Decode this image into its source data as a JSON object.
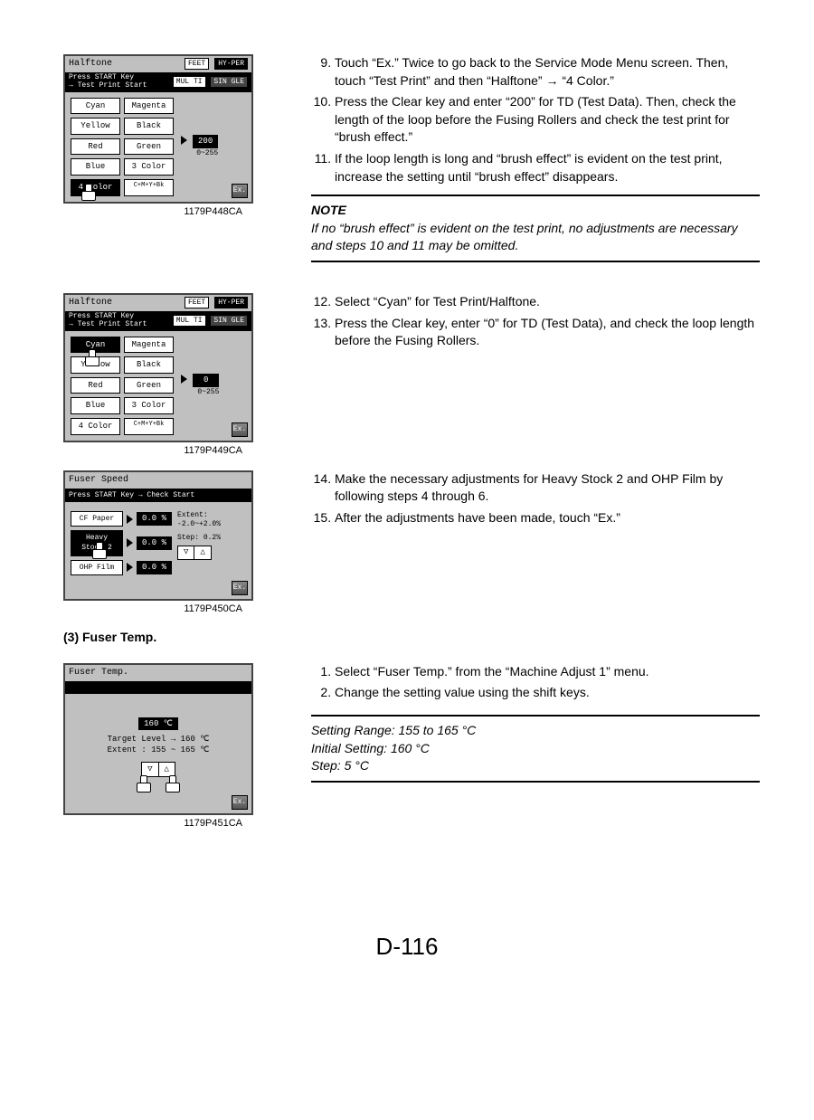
{
  "page_number": "D-116",
  "section_head": "(3)    Fuser Temp.",
  "panel1": {
    "title": "Halftone",
    "feet": "FEET",
    "hyper": "HY-PER",
    "bar": "Press START Key\n→ Test Print Start",
    "mul": "MUL TI",
    "sin": "SIN GLE",
    "c11": "Cyan",
    "c12": "Magenta",
    "c21": "Yellow",
    "c22": "Black",
    "c31": "Red",
    "c32": "Green",
    "c41": "Blue",
    "c42": "3 Color",
    "c51": "4 Color",
    "c52": "C+M+Y+Bk",
    "val": "200",
    "range": "0~255",
    "caption": "1179P448CA"
  },
  "panel2": {
    "title": "Halftone",
    "feet": "FEET",
    "hyper": "HY-PER",
    "bar": "Press START Key\n→ Test Print Start",
    "mul": "MUL TI",
    "sin": "SIN GLE",
    "c11": "Cyan",
    "c12": "Magenta",
    "c21": "Yellow",
    "c22": "Black",
    "c31": "Red",
    "c32": "Green",
    "c41": "Blue",
    "c42": "3 Color",
    "c51": "4 Color",
    "c52": "C+M+Y+Bk",
    "val": "0",
    "range": "0~255",
    "caption": "1179P449CA"
  },
  "panel3": {
    "title": "Fuser Speed",
    "bar": "Press START Key → Check Start",
    "b1": "CF Paper",
    "b2": "Heavy Stock 2",
    "b3": "OHP Film",
    "v": "0.0 %",
    "extent": "Extent:\n-2.0~+2.0%",
    "step": "Step: 0.2%",
    "caption": "1179P450CA"
  },
  "panel4": {
    "title": "Fuser Temp.",
    "val": "160 ℃",
    "target": "Target Level → 160 ℃",
    "extent": "Extent :  155 ~ 165 ℃",
    "caption": "1179P451CA"
  },
  "steps_a": {
    "s9": "Touch “Ex.” Twice to go back to the Service Mode Menu screen.  Then, touch “Test Print” and then “Halftone” → “4 Color.”",
    "s10": "Press the Clear key and enter “200” for TD (Test Data).  Then, check the length of the loop before the Fusing Rollers and check the test print for “brush effect.”",
    "s11": "If the loop length is long and “brush effect” is evident on the test print, increase the setting until “brush effect” disappears."
  },
  "note": {
    "title": "NOTE",
    "body": "If no “brush effect” is evident on the test print, no adjustments are necessary and steps 10 and 11 may be omitted."
  },
  "steps_b": {
    "s12": "Select “Cyan” for Test Print/Halftone.",
    "s13": "Press the Clear key, enter “0” for TD (Test Data), and check the loop length before the Fusing Rollers."
  },
  "steps_c": {
    "s14": "Make the necessary adjustments for Heavy Stock 2 and OHP Film by following steps 4 through 6.",
    "s15": "After the adjustments have been made, touch “Ex.”"
  },
  "steps_d": {
    "s1": "Select “Fuser Temp.” from the “Machine Adjust 1” menu.",
    "s2": "Change the setting value using the shift keys."
  },
  "setting": {
    "l1": "Setting Range: 155 to 165 °C",
    "l2": "Initial Setting: 160 °C",
    "l3": "Step: 5 °C"
  }
}
